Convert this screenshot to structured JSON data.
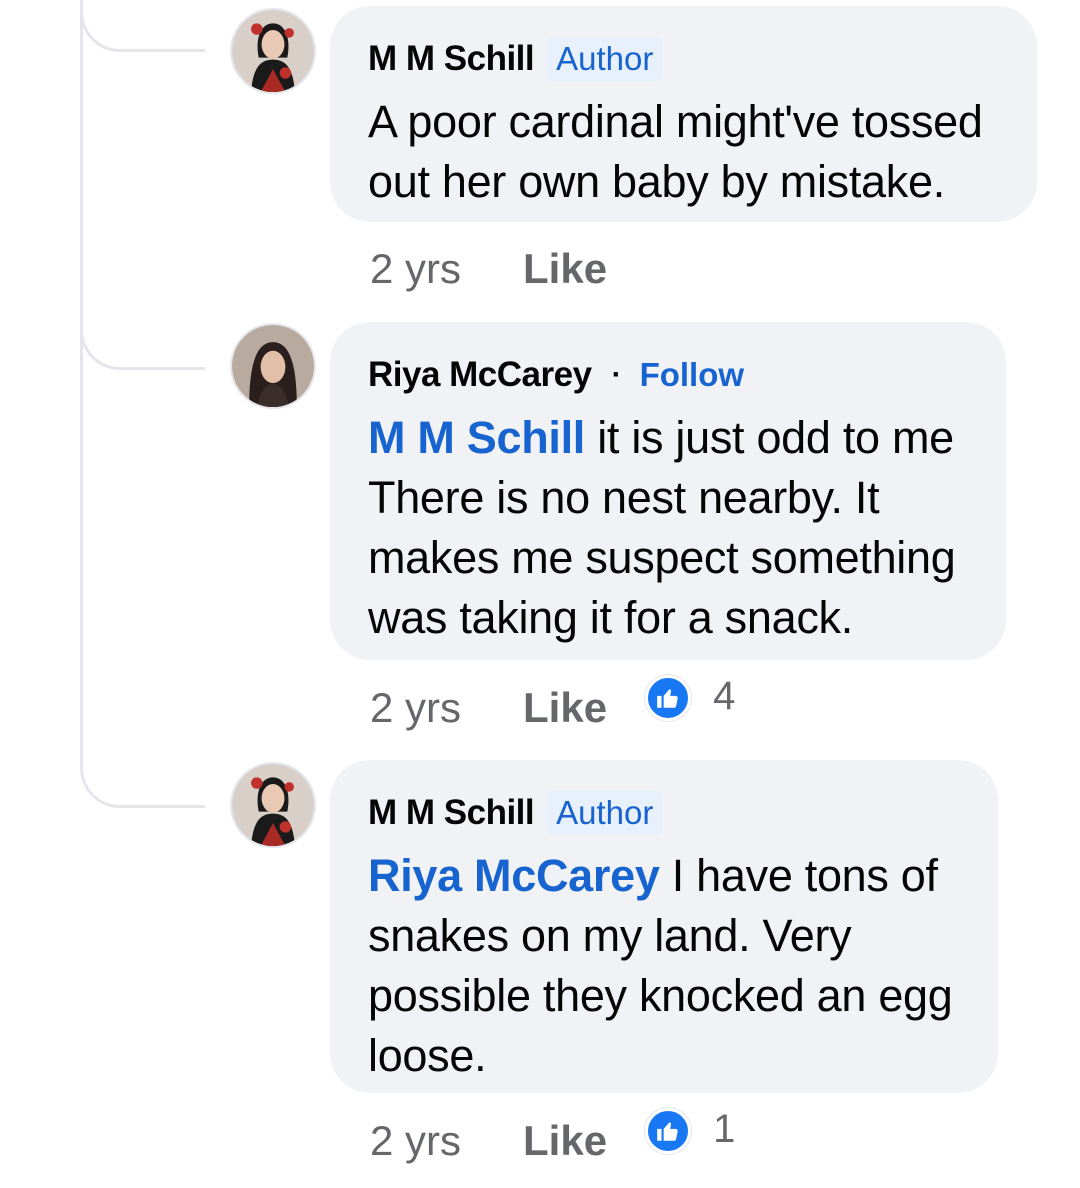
{
  "comments": [
    {
      "author": "M M Schill",
      "badge": "Author",
      "text": "A poor cardinal might've tossed out her own baby by mistake.",
      "time": "2 yrs",
      "like_label": "Like"
    },
    {
      "author": "Riya McCarey",
      "separator": "·",
      "follow_label": "Follow",
      "mention": "M M Schill",
      "text": " it is just odd to me There is no nest nearby. It makes me suspect something was taking it for a snack.",
      "time": "2 yrs",
      "like_label": "Like",
      "reaction_count": "4",
      "reaction_icon": "thumbs-up-icon"
    },
    {
      "author": "M M Schill",
      "badge": "Author",
      "mention": "Riya McCarey",
      "text": " I have tons of snakes on my land. Very possible they knocked an egg loose.",
      "time": "2 yrs",
      "like_label": "Like",
      "reaction_count": "1",
      "reaction_icon": "thumbs-up-icon"
    }
  ],
  "colors": {
    "bubble": "#f0f2f5",
    "link": "#1763cf",
    "reaction": "#1877f2",
    "meta": "#65676b"
  }
}
